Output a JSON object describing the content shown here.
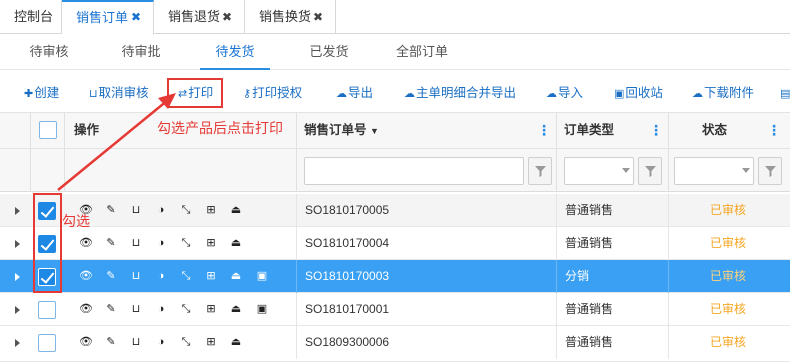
{
  "top_tabs": [
    {
      "label": "控制台",
      "closable": false,
      "active": false
    },
    {
      "label": "销售订单",
      "closable": true,
      "active": true
    },
    {
      "label": "销售退货",
      "closable": true,
      "active": false
    },
    {
      "label": "销售换货",
      "closable": true,
      "active": false
    }
  ],
  "sub_tabs": [
    {
      "label": "待审核",
      "active": false
    },
    {
      "label": "待审批",
      "active": false
    },
    {
      "label": "待发货",
      "active": true
    },
    {
      "label": "已发货",
      "active": false
    },
    {
      "label": "全部订单",
      "active": false
    }
  ],
  "toolbar": {
    "create": "创建",
    "cancel_audit": "取消审核",
    "print": "打印",
    "print_auth": "打印授权",
    "export": "导出",
    "export_merged": "主单明细合并导出",
    "import": "导入",
    "recycle": "回收站",
    "download_attach": "下载附件"
  },
  "grid": {
    "headers": {
      "operation": "操作",
      "order_no": "销售订单号",
      "order_type": "订单类型",
      "status": "状态"
    },
    "rows": [
      {
        "order_no": "SO1810170005",
        "order_type": "普通销售",
        "status": "已审核",
        "checked": true
      },
      {
        "order_no": "SO1810170004",
        "order_type": "普通销售",
        "status": "已审核",
        "checked": true
      },
      {
        "order_no": "SO1810170003",
        "order_type": "分销",
        "status": "已审核",
        "checked": true,
        "selected": true
      },
      {
        "order_no": "SO1810170001",
        "order_type": "普通销售",
        "status": "已审核",
        "checked": false
      },
      {
        "order_no": "SO1809300006",
        "order_type": "普通销售",
        "status": "已审核",
        "checked": false
      }
    ]
  },
  "annotations": {
    "print_hint": "勾选产品后点击打印",
    "check_hint": "勾选"
  },
  "colors": {
    "accent": "#1a73d2",
    "selected_row": "#3aa0f3",
    "status": "#f5a623",
    "annotation": "#e53935"
  }
}
